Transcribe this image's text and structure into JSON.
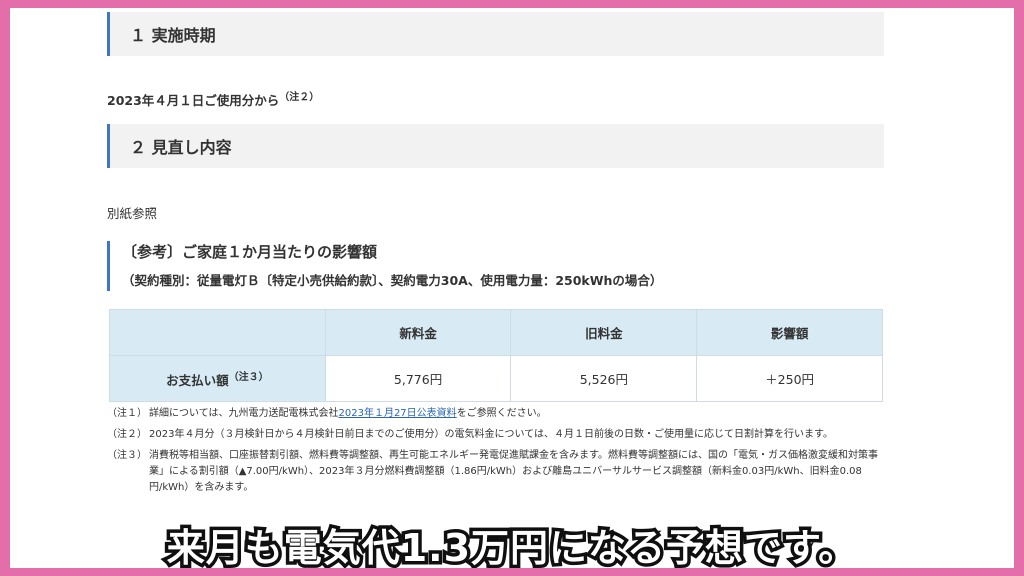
{
  "section1": {
    "title": "１ 実施時期"
  },
  "section1_body": {
    "text": "2023年４月１日ご使用分から",
    "note_ref": "（注２）"
  },
  "section2": {
    "title": "２ 見直し内容"
  },
  "section2_body": {
    "text": "別紙参照"
  },
  "reference": {
    "title": "〔参考〕ご家庭１か月当たりの影響額",
    "subtitle": "（契約種別：従量電灯Ｂ〔特定小売供給約款〕、契約電力30A、使用電力量：250kWhの場合）"
  },
  "table": {
    "headers": [
      "",
      "新料金",
      "旧料金",
      "影響額"
    ],
    "row_label": "お支払い額",
    "row_note": "（注３）",
    "values": [
      "5,776円",
      "5,526円",
      "＋250円"
    ]
  },
  "notes": [
    {
      "mark": "（注１）",
      "before": "詳細については、九州電力送配電株式会社",
      "link": "2023年１月27日公表資料",
      "after": "をご参照ください。"
    },
    {
      "mark": "（注２）",
      "text": "2023年４月分（３月検針日から４月検針日前日までのご使用分）の電気料金については、４月１日前後の日数・ご使用量に応じて日割計算を行います。"
    },
    {
      "mark": "（注３）",
      "text": "消費税等相当額、口座振替割引額、燃料費等調整額、再生可能エネルギー発電促進賦課金を含みます。燃料費等調整額には、国の「電気・ガス価格激変緩和対策事業」による割引額（▲7.00円/kWh）、2023年３月分燃料費調整額（1.86円/kWh）および離島ユニバーサルサービス調整額（新料金0.03円/kWh、旧料金0.08円/kWh）を含みます。"
    }
  ],
  "caption": {
    "text": "来月も電気代1.3万円になる予想です。"
  },
  "colors": {
    "frame": "#e46ea9",
    "accent": "#3f74c6",
    "table_header": "#d8ebf5",
    "link": "#2a66b8"
  }
}
